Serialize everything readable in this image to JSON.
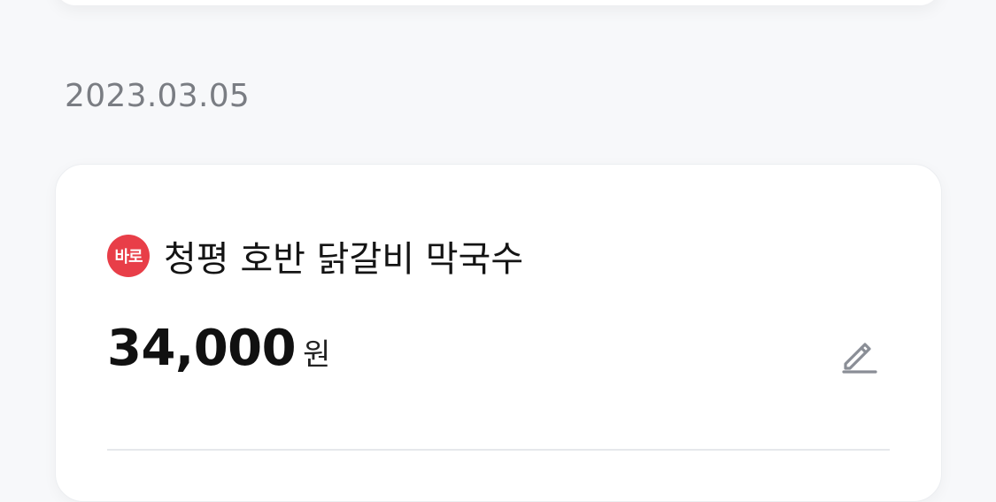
{
  "date_group": {
    "date": "2023.03.05"
  },
  "transaction": {
    "brand_badge_text": "바로",
    "brand_icon": "baro-logo-icon",
    "store_name": "청평 호반 닭갈비 막국수",
    "amount": "34,000",
    "currency_unit": "원",
    "edit_icon": "pencil-icon"
  },
  "colors": {
    "background": "#f7f8fa",
    "card": "#ffffff",
    "brand_red": "#e83e48",
    "date_text": "#7a7d83",
    "icon_gray": "#8a8e96"
  }
}
